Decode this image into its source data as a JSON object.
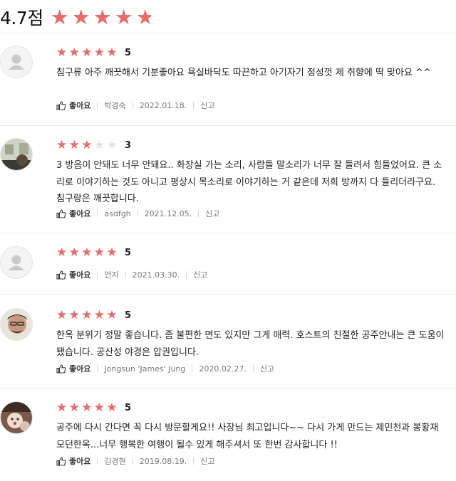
{
  "summary": {
    "score": "4.7점",
    "rating": 4.7,
    "star_color": "#e86a6a",
    "empty_star_color": "#e2e2e2"
  },
  "like_label": "좋아요",
  "report_label": "신고",
  "reviews": [
    {
      "rating": 5,
      "rating_label": "5",
      "text": "침구류 아주 깨끗해서 기분좋아요 욕실바닥도 따끈하고 아기자기 정성껏 제 취향에 딱 맞아요 ^^",
      "author": "박경숙",
      "date": "2022.01.18.",
      "avatar": "default-avatar-icon"
    },
    {
      "rating": 3,
      "rating_label": "3",
      "text": "3 방음이 안돼도 너무 안돼요.. 화장실 가는 소리, 사람들 말소리가 너무 잘 들려서 힘들었어요. 큰 소리로 이야기하는 것도 아니고 평상시 목소리로 이야기하는 거 같은데 저희 방까지 다 들리더라구요. 침구랑은 깨끗합니다.",
      "author": "asdfgh",
      "date": "2021.12.05.",
      "avatar": "photo-avatar"
    },
    {
      "rating": 5,
      "rating_label": "5",
      "text": "",
      "author": "먼지",
      "date": "2021.03.30.",
      "avatar": "default-avatar-icon"
    },
    {
      "rating": 5,
      "rating_label": "5",
      "text": "한옥 분위기 정말 좋습니다. 좀 불편한 면도 있지만 그게 매력. 호스트의 친절한 공주안내는 큰 도움이 됐습니다. 공산성 야경은 압권입니다.",
      "author": "Jongsun 'James' Jung",
      "date": "2020.02.27.",
      "avatar": "photo-avatar"
    },
    {
      "rating": 5,
      "rating_label": "5",
      "text": "공주에 다시 간다면 꼭 다시 방문할게요!! 사장님 최고입니다~~ 다시 가게 만드는 제민천과 봉황재모던한옥...너무 행복한 여행이 될수 있게 해주셔서 또 한번 감사합니다 !!",
      "author": "김경현",
      "date": "2019.08.19.",
      "avatar": "photo-avatar"
    }
  ]
}
